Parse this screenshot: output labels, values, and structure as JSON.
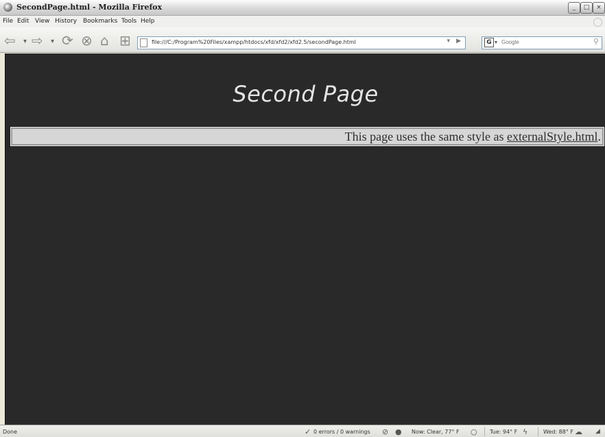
{
  "window": {
    "title": "SecondPage.html - Mozilla Firefox",
    "minimize": "_",
    "maximize": "□",
    "close": "×"
  },
  "menu": {
    "file": "File",
    "edit": "Edit",
    "view": "View",
    "history": "History",
    "bookmarks": "Bookmarks",
    "tools": "Tools",
    "help": "Help"
  },
  "toolbar": {
    "url": "file:///C:/Program%20Files/xampp/htdocs/xfd/xfd2/xfd2.5/secondPage.html",
    "search_placeholder": "Google",
    "search_engine_letter": "G"
  },
  "content": {
    "heading": "Second Page",
    "notice_prefix": "This page uses the same style as ",
    "notice_link": "externalStyle.html",
    "notice_suffix": "."
  },
  "status": {
    "text": "Done",
    "errors": "0 errors / 0 warnings",
    "weather_now": "Now: Clear, 77° F",
    "weather_tue": "Tue: 94° F",
    "weather_wed": "Wed: 88° F"
  },
  "colors": {
    "page_background": "#292929",
    "heading": "#e4e4e4",
    "notice_background": "#d6d6d6"
  }
}
